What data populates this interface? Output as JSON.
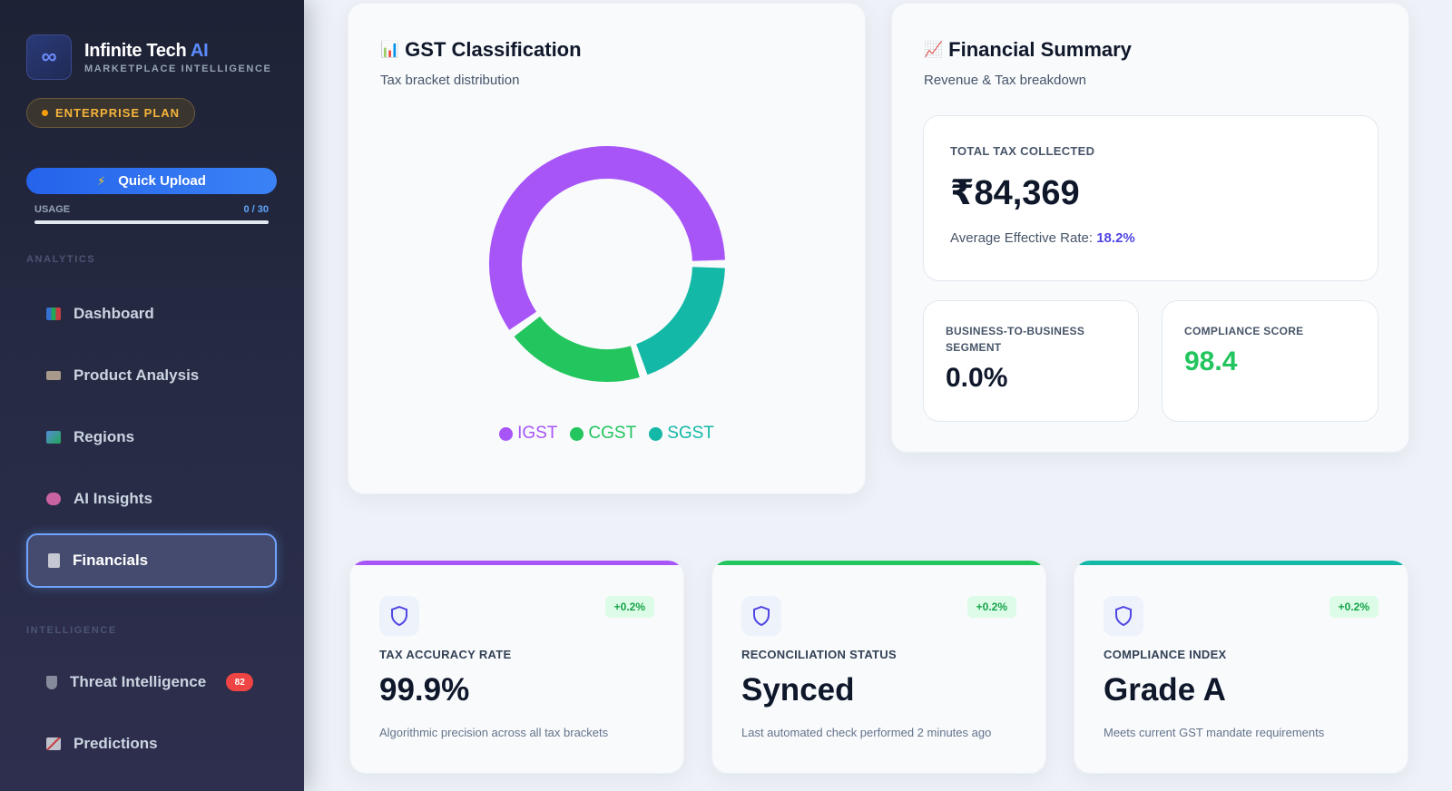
{
  "sidebar": {
    "brand_name": "Infinite Tech",
    "brand_ai": "AI",
    "brand_sub": "MARKETPLACE INTELLIGENCE",
    "plan": "ENTERPRISE PLAN",
    "upload_label": "Quick Upload",
    "usage_label": "USAGE",
    "usage_count": "0 / 30",
    "section_analytics": "ANALYTICS",
    "section_intelligence": "INTELLIGENCE",
    "items": [
      {
        "label": "Dashboard",
        "icon": "bar-chart-icon"
      },
      {
        "label": "Product Analysis",
        "icon": "tag-icon"
      },
      {
        "label": "Regions",
        "icon": "map-icon"
      },
      {
        "label": "AI Insights",
        "icon": "brain-icon"
      },
      {
        "label": "Financials",
        "icon": "receipt-icon",
        "active": true
      },
      {
        "label": "Threat Intelligence",
        "icon": "shield-icon",
        "badge": "82"
      },
      {
        "label": "Predictions",
        "icon": "trend-icon"
      }
    ]
  },
  "gst": {
    "title": "GST Classification",
    "subtitle": "Tax bracket distribution",
    "legend": [
      "IGST",
      "CGST",
      "SGST"
    ]
  },
  "chart_data": {
    "type": "pie",
    "categories": [
      "IGST",
      "CGST",
      "SGST"
    ],
    "values": [
      60,
      20,
      20
    ],
    "colors": [
      "#a855f7",
      "#22c55e",
      "#14b8a6"
    ]
  },
  "financial": {
    "title": "Financial Summary",
    "subtitle": "Revenue & Tax breakdown",
    "total_label": "TOTAL TAX COLLECTED",
    "total_value": "₹84,369",
    "rate_label": "Average Effective Rate:",
    "rate_value": "18.2%",
    "b2b_label": "BUSINESS-TO-BUSINESS SEGMENT",
    "b2b_value": "0.0%",
    "compliance_label": "COMPLIANCE SCORE",
    "compliance_value": "98.4"
  },
  "metrics": [
    {
      "label": "TAX ACCURACY RATE",
      "value": "99.9%",
      "delta": "+0.2%",
      "desc": "Algorithmic precision across all tax brackets",
      "color": "#a855f7"
    },
    {
      "label": "RECONCILIATION STATUS",
      "value": "Synced",
      "delta": "+0.2%",
      "desc": "Last automated check performed 2 minutes ago",
      "color": "#22c55e"
    },
    {
      "label": "COMPLIANCE INDEX",
      "value": "Grade A",
      "delta": "+0.2%",
      "desc": "Meets current GST mandate requirements",
      "color": "#14b8a6"
    }
  ]
}
